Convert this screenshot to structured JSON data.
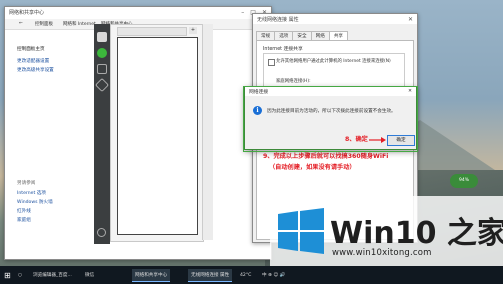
{
  "control_panel": {
    "title": "网络和共享中心",
    "breadcrumb": [
      "控制面板",
      "网络和 Internet",
      "网络和共享中心"
    ],
    "left_links": [
      "控制面板主页",
      "更改适配器设置",
      "更改高级共享设置"
    ],
    "see_also_header": "另请参阅",
    "see_also": [
      "Internet 选项",
      "Windows 防火墙",
      "红外线",
      "家庭组"
    ],
    "search_icon": "search-icon"
  },
  "side_app": {
    "panel_title": "",
    "icons": [
      "window-icon",
      "chat-icon",
      "contacts-icon",
      "cube-icon",
      "settings-icon"
    ]
  },
  "properties": {
    "title": "无线网络连接 属性",
    "tabs": [
      "常规",
      "选项",
      "安全",
      "网络",
      "共享"
    ],
    "active_tab": 4,
    "group_title": "Internet 连接共享",
    "checkbox_label": "允许其他网络用户通过此计算机的 Internet 连接来连接(N)",
    "home_label": "家庭网络连接(H):",
    "close_label": "✕"
  },
  "popup": {
    "title": "网络连接",
    "message": "因为此连接目前为活动的，所以下次拨此连接前设置不会生效。",
    "step_label": "8、确定",
    "ok_label": "确定"
  },
  "annotation": {
    "line1": "9、完成以上步骤后就可以找搞360随身WiFi",
    "line2": "（自动创建，如果没有请手动）"
  },
  "badge": {
    "text": "94%"
  },
  "taskbar": {
    "items": [
      "浏览编辑器_百度...",
      "微信",
      "网络和共享中心",
      "无线网络连接 属性"
    ],
    "temperature": "42°C",
    "tray": "中 ⊕ ☺ 🔊"
  },
  "banner": {
    "brand": "Win10 之家",
    "url": "www.win10xitong.com"
  },
  "colors": {
    "accent": "#1a6fd6",
    "annotation_red": "#e41e26",
    "highlight_green": "#45a843"
  }
}
